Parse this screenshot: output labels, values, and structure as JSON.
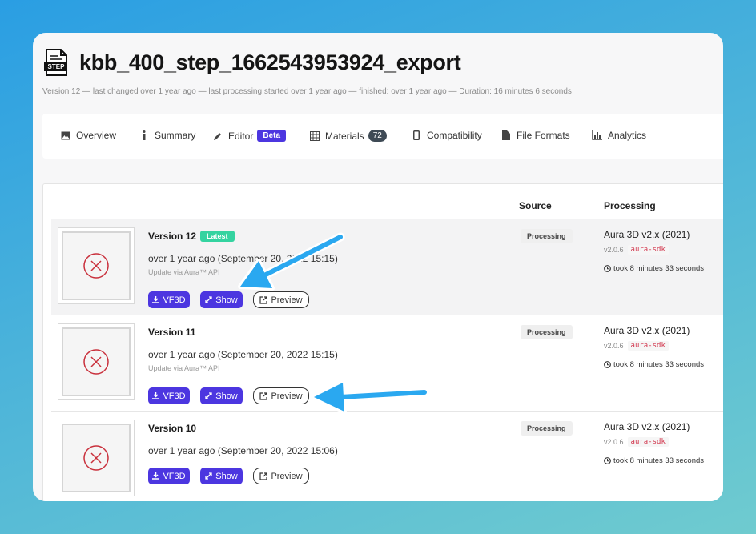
{
  "header": {
    "title": "kbb_400_step_1662543953924_export",
    "icon_label": "STEP",
    "meta": "Version 12 — last changed over 1 year ago — last processing started over 1 year ago — finished: over 1 year ago — Duration: 16 minutes 6 seconds"
  },
  "tabs": [
    {
      "label": "Overview",
      "icon": "image-icon"
    },
    {
      "label": "Summary",
      "icon": "info-icon"
    },
    {
      "label": "Editor",
      "icon": "pencil-icon",
      "badge": "Beta"
    },
    {
      "label": "Materials",
      "icon": "grid-icon",
      "count": "72"
    },
    {
      "label": "Compatibility",
      "icon": "phone-icon"
    },
    {
      "label": "File Formats",
      "icon": "file-icon"
    },
    {
      "label": "Analytics",
      "icon": "bar-chart-icon"
    }
  ],
  "table": {
    "col_source": "Source",
    "col_processing": "Processing"
  },
  "versions": [
    {
      "title": "Version 12",
      "latest": "Latest",
      "date": "over 1 year ago (September 20, 2022 15:15)",
      "via": "Update via Aura™ API",
      "btn_vf3d": "VF3D",
      "btn_show": "Show",
      "btn_preview": "Preview",
      "source": "Processing",
      "proc_name": "Aura 3D v2.x (2021)",
      "proc_ver": "v2.0.6",
      "sdk": "aura-sdk",
      "took": "took 8 minutes 33 seconds"
    },
    {
      "title": "Version 11",
      "date": "over 1 year ago (September 20, 2022 15:15)",
      "via": "Update via Aura™ API",
      "btn_vf3d": "VF3D",
      "btn_show": "Show",
      "btn_preview": "Preview",
      "source": "Processing",
      "proc_name": "Aura 3D v2.x (2021)",
      "proc_ver": "v2.0.6",
      "sdk": "aura-sdk",
      "took": "took 8 minutes 33 seconds"
    },
    {
      "title": "Version 10",
      "date": "over 1 year ago (September 20, 2022 15:06)",
      "btn_vf3d": "VF3D",
      "btn_show": "Show",
      "btn_preview": "Preview",
      "source": "Processing",
      "proc_name": "Aura 3D v2.x (2021)",
      "proc_ver": "v2.0.6",
      "sdk": "aura-sdk",
      "took": "took 8 minutes 33 seconds"
    }
  ],
  "colors": {
    "accent": "#4c36e0",
    "latest": "#34d3a0",
    "arrow": "#2aa8f0",
    "error": "#c9303c"
  }
}
